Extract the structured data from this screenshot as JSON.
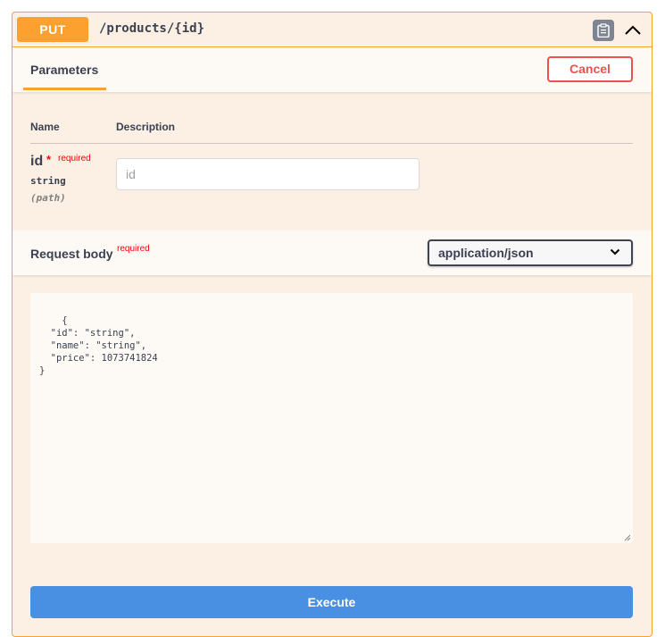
{
  "operation": {
    "method": "PUT",
    "path": "/products/{id}",
    "copy_icon": "clipboard-icon",
    "collapse_icon": "chevron-up-icon"
  },
  "parameters_section": {
    "tab_label": "Parameters",
    "cancel_label": "Cancel",
    "columns": {
      "name": "Name",
      "description": "Description"
    },
    "params": [
      {
        "name": "id",
        "required_star": "*",
        "required_label": "required",
        "type": "string",
        "location": "(path)",
        "placeholder": "id",
        "value": ""
      }
    ]
  },
  "request_body": {
    "title": "Request body",
    "required_label": "required",
    "content_type": "application/json",
    "example": "{\n  \"id\": \"string\",\n  \"name\": \"string\",\n  \"price\": 1073741824\n}"
  },
  "execute_label": "Execute",
  "colors": {
    "put_accent": "#fca130",
    "panel_bg": "#fcf0e4",
    "cancel_red": "#ef5050",
    "execute_blue": "#4990e2"
  }
}
